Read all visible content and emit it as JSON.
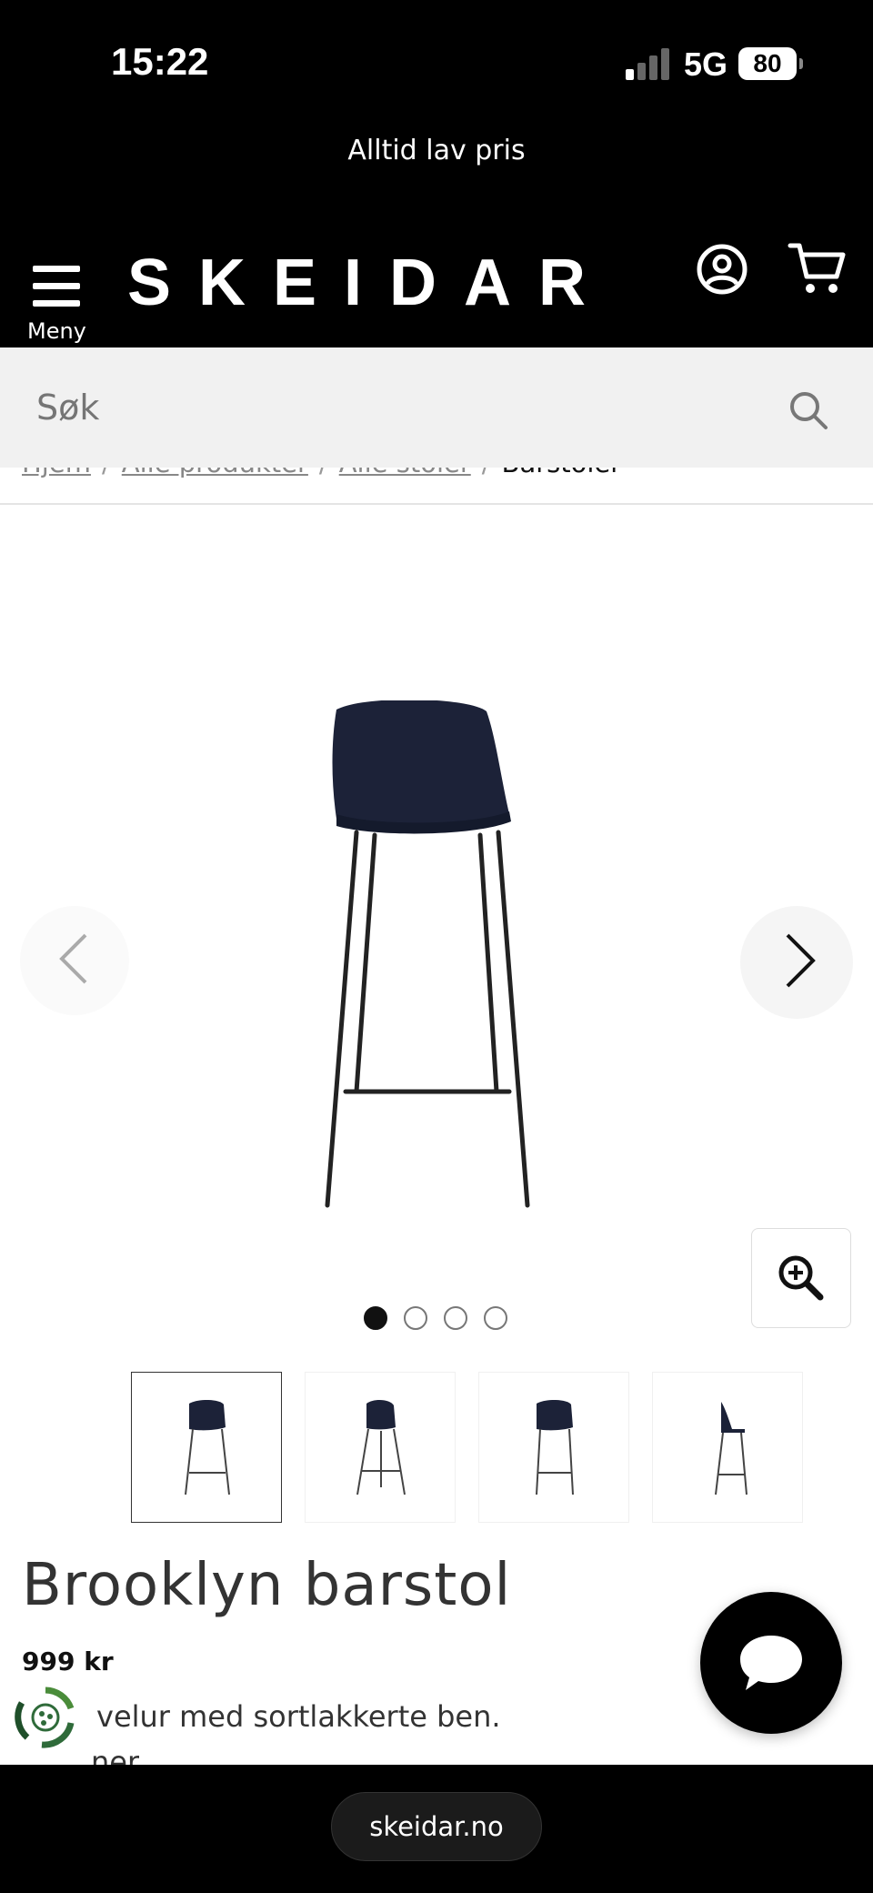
{
  "status_bar": {
    "time": "15:22",
    "network": "5G",
    "battery": "80"
  },
  "promo": {
    "text": "Alltid lav pris"
  },
  "header": {
    "logo": "SKEIDAR",
    "menu_label": "Meny"
  },
  "search": {
    "placeholder": "Søk"
  },
  "breadcrumb": {
    "items": [
      "Hjem",
      "Alle produkter",
      "Alle stoler"
    ],
    "current": "Barstoler",
    "separator": "/"
  },
  "gallery": {
    "image_count": 4,
    "active_index": 0
  },
  "product": {
    "title": "Brooklyn barstol",
    "price": "999 kr",
    "description_line1": "velur med sortlakkerte ben.",
    "description_line2": "ner"
  },
  "browser": {
    "url": "skeidar.no"
  },
  "colors": {
    "header_bg": "#000000",
    "search_bg": "#f1f1f1",
    "chair": "#1c2238",
    "eco_green": "#2f6b3a"
  },
  "icons": [
    "menu-icon",
    "account-icon",
    "cart-icon",
    "search-icon",
    "chevron-left-icon",
    "chevron-right-icon",
    "zoom-in-icon",
    "eco-badge-icon",
    "chat-icon"
  ]
}
